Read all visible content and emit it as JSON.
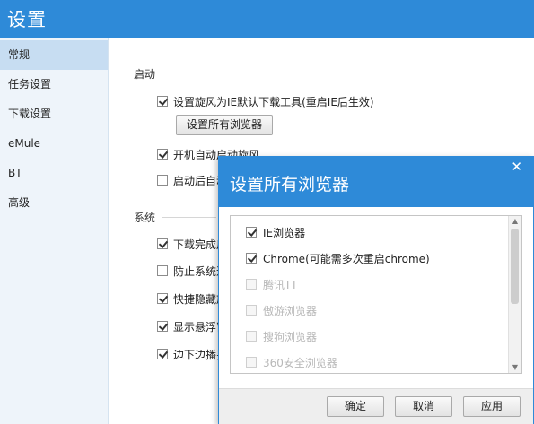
{
  "window": {
    "title": "设置"
  },
  "sidebar": {
    "items": [
      {
        "label": "常规",
        "active": true
      },
      {
        "label": "任务设置"
      },
      {
        "label": "下载设置"
      },
      {
        "label": "eMule"
      },
      {
        "label": "BT"
      },
      {
        "label": "高级"
      }
    ]
  },
  "startup": {
    "section_label": "启动",
    "options": [
      {
        "label": "设置旋风为IE默认下载工具(重启IE后生效)",
        "checked": true
      },
      {
        "label": "开机自动启动旋风",
        "checked": true
      },
      {
        "label": "启动后自动",
        "checked": false
      }
    ],
    "set_browsers_button": "设置所有浏览器"
  },
  "system": {
    "section_label": "系统",
    "options": [
      {
        "label": "下载完成后",
        "checked": true
      },
      {
        "label": "防止系统进",
        "checked": false
      },
      {
        "label": "快捷隐藏旋",
        "checked": true
      },
      {
        "label": "显示悬浮窗",
        "checked": true
      },
      {
        "label": "边下边播另",
        "checked": true
      }
    ]
  },
  "dialog": {
    "title": "设置所有浏览器",
    "close_icon": "close-icon",
    "browsers": [
      {
        "label": "IE浏览器",
        "checked": true,
        "enabled": true
      },
      {
        "label": "Chrome(可能需多次重启chrome)",
        "checked": true,
        "enabled": true
      },
      {
        "label": "腾讯TT",
        "checked": false,
        "enabled": false
      },
      {
        "label": "傲游浏览器",
        "checked": false,
        "enabled": false
      },
      {
        "label": "搜狗浏览器",
        "checked": false,
        "enabled": false
      },
      {
        "label": "360安全浏览器",
        "checked": false,
        "enabled": false
      }
    ],
    "buttons": {
      "ok": "确定",
      "cancel": "取消",
      "apply": "应用"
    }
  },
  "colors": {
    "accent": "#2e8ad8",
    "sidebar_bg": "#eef4fa",
    "sidebar_active": "#c7ddf2"
  }
}
